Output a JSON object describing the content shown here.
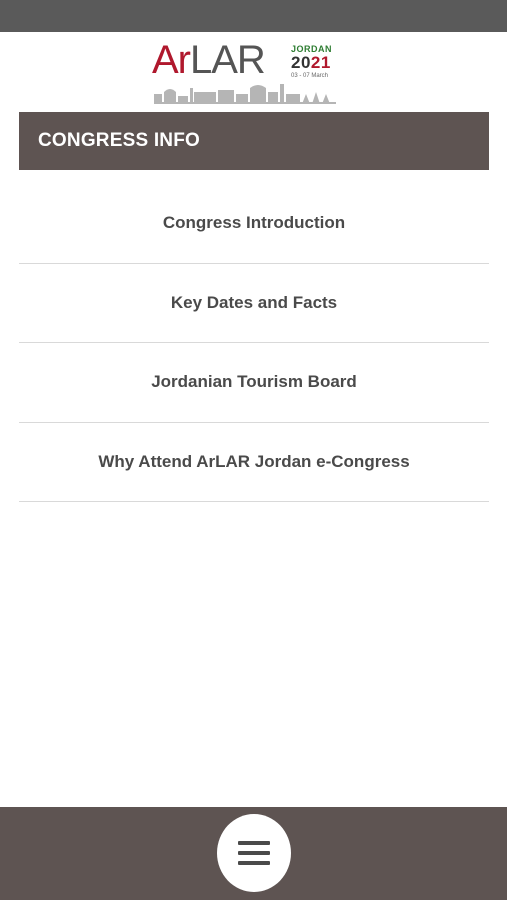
{
  "logo": {
    "word_ar": "Ar",
    "word_lar": "LAR",
    "country": "JORDAN",
    "year_a": "20",
    "year_b": "21",
    "dates": "03 - 07 March",
    "brand_red": "#b0182d",
    "brand_green": "#2e7d32"
  },
  "header": {
    "title": "CONGRESS INFO",
    "color": "#5e5452"
  },
  "menu": {
    "items": [
      {
        "label": "Congress Introduction"
      },
      {
        "label": "Key Dates and Facts"
      },
      {
        "label": "Jordanian Tourism Board"
      },
      {
        "label": "Why Attend ArLAR Jordan e-Congress"
      }
    ]
  },
  "bottom_bar": {
    "menu_icon": "hamburger-menu-icon"
  }
}
